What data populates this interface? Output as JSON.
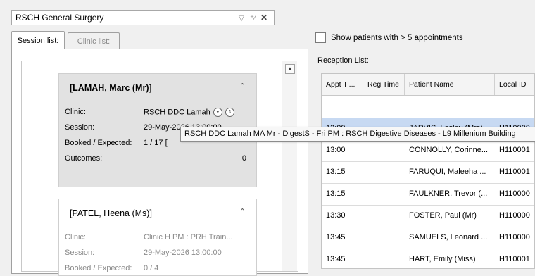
{
  "header": {
    "combo_value": "RSCH General Surgery"
  },
  "tabs": [
    {
      "label": "Session list:"
    },
    {
      "label": "Clinic list:"
    }
  ],
  "sessions": [
    {
      "title": "[LAMAH, Marc (Mr)]",
      "clinic_label": "Clinic:",
      "clinic_value": "RSCH DDC Lamah",
      "session_label": "Session:",
      "session_value": "29-May-2026 13:00:00",
      "booked_label": "Booked / Expected:",
      "booked_value": "1 / 17  [",
      "outcomes_label": "Outcomes:",
      "outcomes_value": "0"
    },
    {
      "title": "[PATEL, Heena (Ms)]",
      "clinic_label": "Clinic:",
      "clinic_value": "Clinic H PM : PRH Train...",
      "session_label": "Session:",
      "session_value": "29-May-2026 13:00:00",
      "booked_label": "Booked / Expected:",
      "booked_value": "0 / 4"
    }
  ],
  "filter": {
    "checkbox_label": "Show patients with > 5 appointments",
    "checked": false
  },
  "reception": {
    "label": "Reception List:",
    "columns": [
      "Appt Ti...",
      "Reg Time",
      "Patient Name",
      "Local ID"
    ],
    "rows": [
      {
        "appt": "",
        "reg": "",
        "name": "",
        "id": ""
      },
      {
        "appt": "13:00",
        "reg": "",
        "name": "JARVIS, Lesley (Mrs)",
        "id": "H110000"
      },
      {
        "appt": "13:00",
        "reg": "",
        "name": "CONNOLLY, Corinne...",
        "id": "H110001"
      },
      {
        "appt": "13:15",
        "reg": "",
        "name": "FARUQUI, Maleeha ...",
        "id": "H110001"
      },
      {
        "appt": "13:15",
        "reg": "",
        "name": "FAULKNER, Trevor (...",
        "id": "H110000"
      },
      {
        "appt": "13:30",
        "reg": "",
        "name": "FOSTER, Paul (Mr)",
        "id": "H110000"
      },
      {
        "appt": "13:45",
        "reg": "",
        "name": "SAMUELS, Leonard ...",
        "id": "H110000"
      },
      {
        "appt": "13:45",
        "reg": "",
        "name": "HART, Emily (Miss)",
        "id": "H110001"
      }
    ]
  },
  "tooltip": {
    "text": "RSCH DDC Lamah MA Mr - DigestS - Fri PM : RSCH Digestive Diseases - L9 Millenium Building"
  },
  "colors": {
    "selected_row": "#c7d9f2",
    "active_card": "#e2e2e2"
  }
}
